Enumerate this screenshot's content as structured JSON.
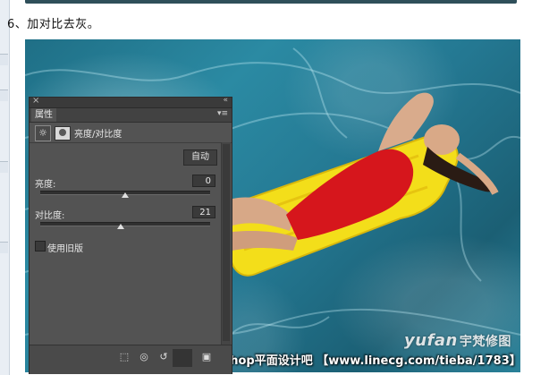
{
  "step_text": "6、加对比去灰。",
  "panel": {
    "tab_label": "属性",
    "adjustment_title": "亮度/对比度",
    "auto_button": "自动",
    "brightness_label": "亮度:",
    "brightness_value": "0",
    "brightness_level": 0,
    "contrast_label": "对比度:",
    "contrast_value": "21",
    "contrast_level": 21,
    "legacy_label": "使用旧版",
    "legacy_checked": false,
    "icons": [
      "close-icon",
      "collapse-icon",
      "panel-menu-icon",
      "brightness-contrast-icon",
      "layer-mask-icon",
      "clip-to-layer-icon",
      "view-previous-icon",
      "reset-icon",
      "visibility-icon",
      "delete-icon"
    ]
  },
  "watermark": {
    "logo_text": "yufan",
    "logo_cn": "宇梵修图",
    "bar_text": "PhotoShop平面设计吧 【www.linecg.com/tieba/1783】"
  },
  "colors": {
    "panel_bg": "#535353",
    "water": "#2b8aa3",
    "float": "#f3de1a",
    "swimsuit": "#d6161c"
  }
}
